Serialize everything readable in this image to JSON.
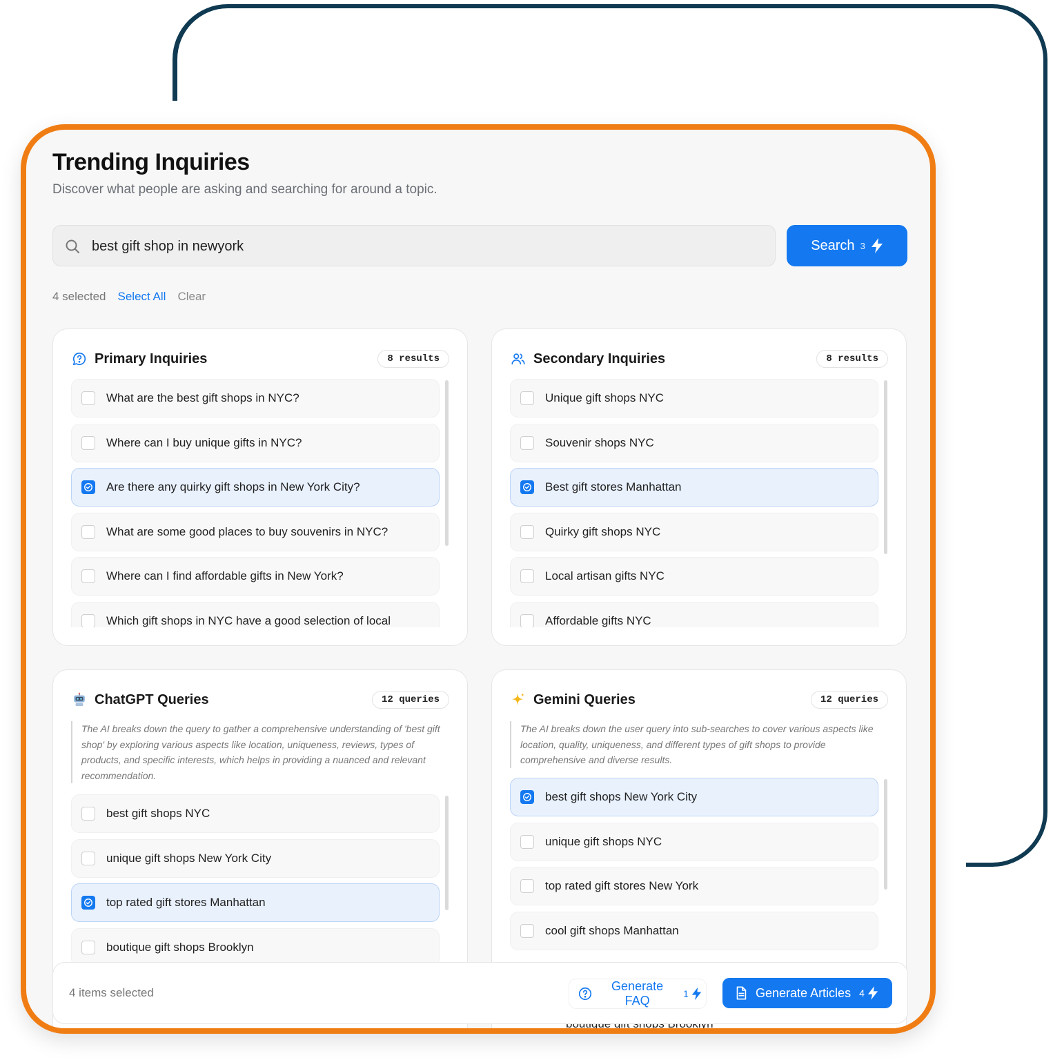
{
  "header": {
    "title": "Trending Inquiries",
    "subtitle": "Discover what people are asking and searching for around a topic."
  },
  "search": {
    "value": "best gift shop in newyork",
    "button_label": "Search",
    "button_credits": "3"
  },
  "selection": {
    "count_label": "4 selected",
    "select_all": "Select All",
    "clear": "Clear"
  },
  "colors": {
    "accent": "#1479f0",
    "frame_orange": "#f07d14",
    "frame_navy": "#0f3a52"
  },
  "primary": {
    "title": "Primary Inquiries",
    "badge": "8 results",
    "icon": "question-bubble-icon",
    "items": [
      {
        "text": "What are the best gift shops in NYC?",
        "checked": false
      },
      {
        "text": "Where can I buy unique gifts in NYC?",
        "checked": false
      },
      {
        "text": "Are there any quirky gift shops in New York City?",
        "checked": true
      },
      {
        "text": "What are some good places to buy souvenirs in NYC?",
        "checked": false
      },
      {
        "text": "Where can I find affordable gifts in New York?",
        "checked": false
      },
      {
        "text": "Which gift shops in NYC have a good selection of local",
        "checked": false
      }
    ]
  },
  "secondary": {
    "title": "Secondary Inquiries",
    "badge": "8 results",
    "icon": "users-icon",
    "items": [
      {
        "text": "Unique gift shops NYC",
        "checked": false
      },
      {
        "text": "Souvenir shops NYC",
        "checked": false
      },
      {
        "text": "Best gift stores Manhattan",
        "checked": true
      },
      {
        "text": "Quirky gift shops NYC",
        "checked": false
      },
      {
        "text": "Local artisan gifts NYC",
        "checked": false
      },
      {
        "text": "Affordable gifts NYC",
        "checked": false
      }
    ]
  },
  "chatgpt": {
    "title": "ChatGPT Queries",
    "badge": "12 queries",
    "icon": "robot-icon",
    "note": "The AI breaks down the query to gather a comprehensive understanding of 'best gift shop' by exploring various aspects like location, uniqueness, reviews, types of products, and specific interests, which helps in providing a nuanced and relevant recommendation.",
    "items": [
      {
        "text": "best gift shops NYC",
        "checked": false
      },
      {
        "text": "unique gift shops New York City",
        "checked": false
      },
      {
        "text": "top rated gift stores Manhattan",
        "checked": true
      },
      {
        "text": "boutique gift shops Brooklyn",
        "checked": false
      }
    ]
  },
  "gemini": {
    "title": "Gemini Queries",
    "badge": "12 queries",
    "icon": "sparkle-icon",
    "note": "The AI breaks down the user query into sub-searches to cover various aspects like location, quality, uniqueness, and different types of gift shops to provide comprehensive and diverse results.",
    "items": [
      {
        "text": "best gift shops New York City",
        "checked": true
      },
      {
        "text": "unique gift shops NYC",
        "checked": false
      },
      {
        "text": "top rated gift stores New York",
        "checked": false
      },
      {
        "text": "cool gift shops Manhattan",
        "checked": false
      }
    ],
    "below_footer_text": "boutique gift shops Brooklyn"
  },
  "footer": {
    "count_label": "4 items selected",
    "faq_label": "Generate FAQ",
    "faq_credits": "1",
    "articles_label": "Generate Articles",
    "articles_credits": "4"
  }
}
